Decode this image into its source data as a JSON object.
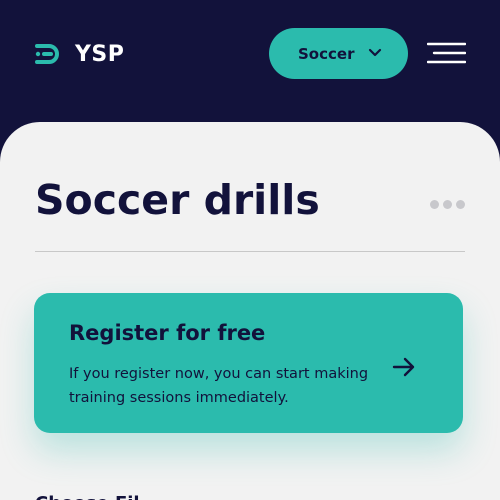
{
  "header": {
    "logo_text": "YSP",
    "logo_icon": "ysp-logo-mark",
    "sport_select": {
      "selected": "Soccer",
      "icon": "chevron-down-icon"
    },
    "menu_icon": "hamburger-menu-icon"
  },
  "main": {
    "title": "Soccer drills",
    "more_icon": "more-horizontal-icon",
    "register_card": {
      "title": "Register for free",
      "description": "If you register now, you can start making training sessions immediately.",
      "icon": "arrow-right-icon"
    },
    "next_section_title": "Choose Fil..."
  },
  "colors": {
    "navy": "#12123b",
    "accent": "#2bbbad",
    "surface": "#f2f2f2",
    "muted": "#c8c8cc"
  }
}
